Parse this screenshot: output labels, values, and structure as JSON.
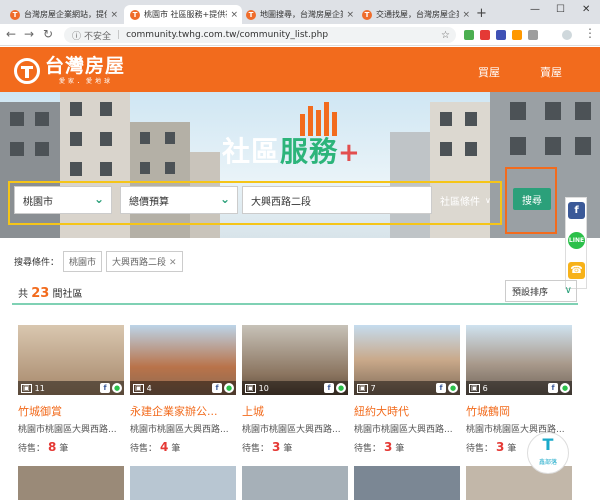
{
  "browser": {
    "tabs": [
      {
        "label": "台灣房屋企業網站，提供",
        "active": false
      },
      {
        "label": "桃園市 社區服務+提供社",
        "active": true
      },
      {
        "label": "地圖搜尋，台灣房屋企業",
        "active": false
      },
      {
        "label": "交通找屋，台灣房屋企業",
        "active": false
      }
    ],
    "new_tab": "+",
    "url_insecure": "不安全",
    "url": "community.twhg.com.tw/community_list.php"
  },
  "site": {
    "logo_name": "台灣房屋",
    "logo_tag": "愛家．愛地球",
    "nav": [
      "買屋",
      "賣屋"
    ]
  },
  "banner": {
    "title_part1": "社區",
    "title_part2": "服務",
    "title_plus": "+"
  },
  "search": {
    "city": "桃園市",
    "budget": "總價預算",
    "address": "大興西路二段",
    "conditions_label": "社區條件",
    "button": "搜尋"
  },
  "share": {
    "fb": "f",
    "line": "LINE",
    "tel": "☎"
  },
  "filters": {
    "label": "搜尋條件：",
    "chips": [
      "桃園市",
      "大興西路二段"
    ]
  },
  "results": {
    "prefix": "共",
    "count": "23",
    "suffix": "間社區",
    "sort": "預設排序"
  },
  "cards": [
    {
      "photos": "11",
      "name": "竹城御賞",
      "addr": "桃園市桃園區大興西路...",
      "sale_label": "待售：",
      "sale": "8",
      "unit": "筆"
    },
    {
      "photos": "4",
      "name": "永建企業家辦公...",
      "addr": "桃園市桃園區大興西路...",
      "sale_label": "待售：",
      "sale": "4",
      "unit": "筆"
    },
    {
      "photos": "10",
      "name": "上城",
      "addr": "桃園市桃園區大興西路...",
      "sale_label": "待售：",
      "sale": "3",
      "unit": "筆"
    },
    {
      "photos": "7",
      "name": "紐約大時代",
      "addr": "桃園市桃園區大興西路...",
      "sale_label": "待售：",
      "sale": "3",
      "unit": "筆"
    },
    {
      "photos": "6",
      "name": "竹城鶴岡",
      "addr": "桃園市桃園區大興西路...",
      "sale_label": "待售：",
      "sale": "3",
      "unit": "筆"
    }
  ],
  "watermark": "鑫部落",
  "colors": {
    "brand": "#f26b1d",
    "green": "#2ba07a",
    "highlight_yellow": "#f5c518"
  }
}
